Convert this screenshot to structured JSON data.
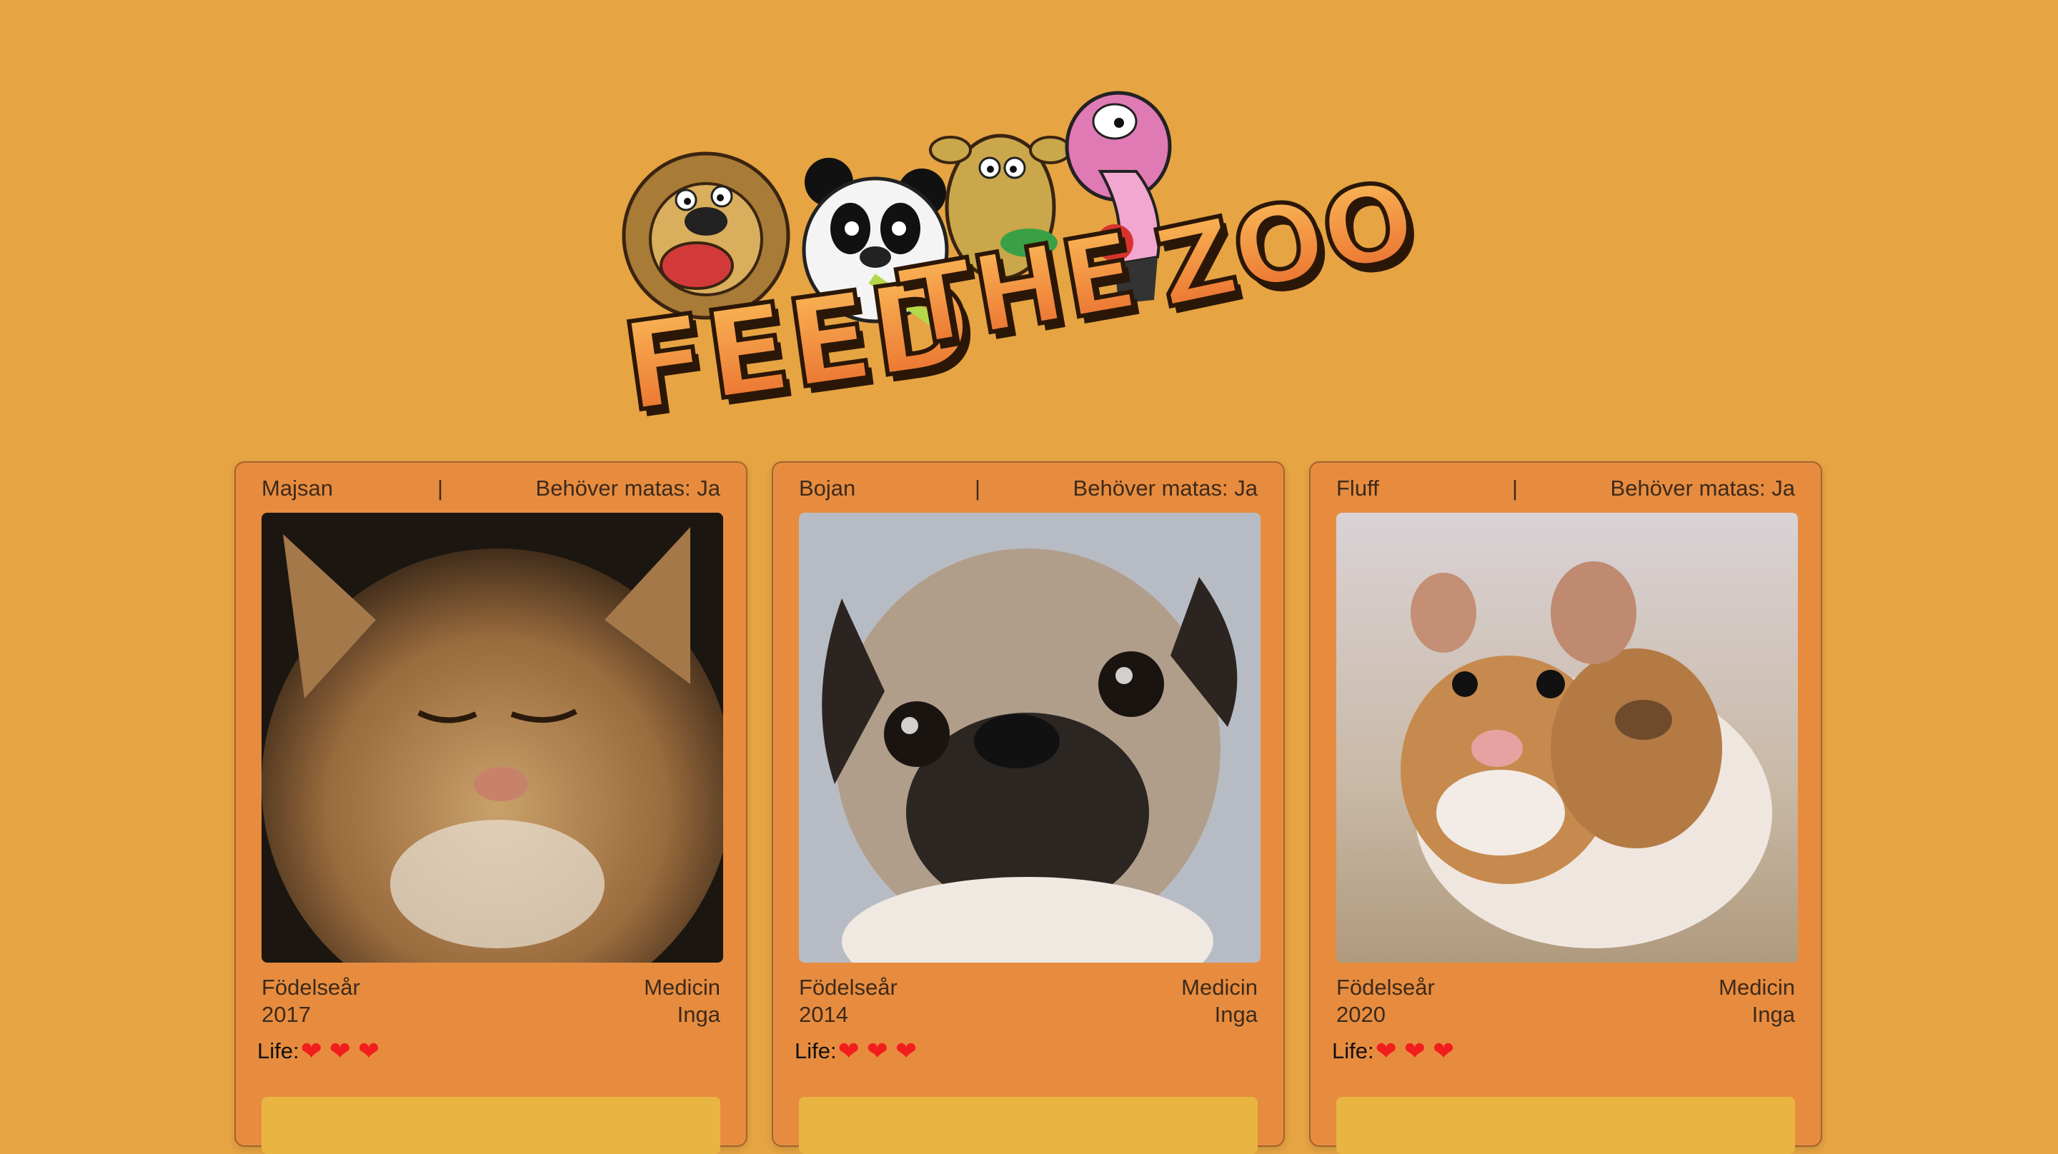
{
  "logo": {
    "alt_text": "FEED THE ZOO"
  },
  "cards": [
    {
      "name": "Majsan",
      "separator": "|",
      "feed_status": "Behöver matas: Ja",
      "birth_label": "Födelseår",
      "birth_year": "2017",
      "medicine_label": "Medicin",
      "medicine_value": "Inga",
      "life_label": "Life:",
      "hearts": [
        "❤",
        "❤",
        "❤"
      ],
      "image": "cat-photo"
    },
    {
      "name": "Bojan",
      "separator": "|",
      "feed_status": "Behöver matas: Ja",
      "birth_label": "Födelseår",
      "birth_year": "2014",
      "medicine_label": "Medicin",
      "medicine_value": "Inga",
      "life_label": "Life:",
      "hearts": [
        "❤",
        "❤",
        "❤"
      ],
      "image": "pug-photo"
    },
    {
      "name": "Fluff",
      "separator": "|",
      "feed_status": "Behöver matas: Ja",
      "birth_label": "Födelseår",
      "birth_year": "2020",
      "medicine_label": "Medicin",
      "medicine_value": "Inga",
      "life_label": "Life:",
      "hearts": [
        "❤",
        "❤",
        "❤"
      ],
      "image": "hamster-photo"
    }
  ],
  "colors": {
    "background": "#e6a443",
    "card": "#e78c3f",
    "heart": "#f21d1d",
    "button": "#e9b542"
  }
}
